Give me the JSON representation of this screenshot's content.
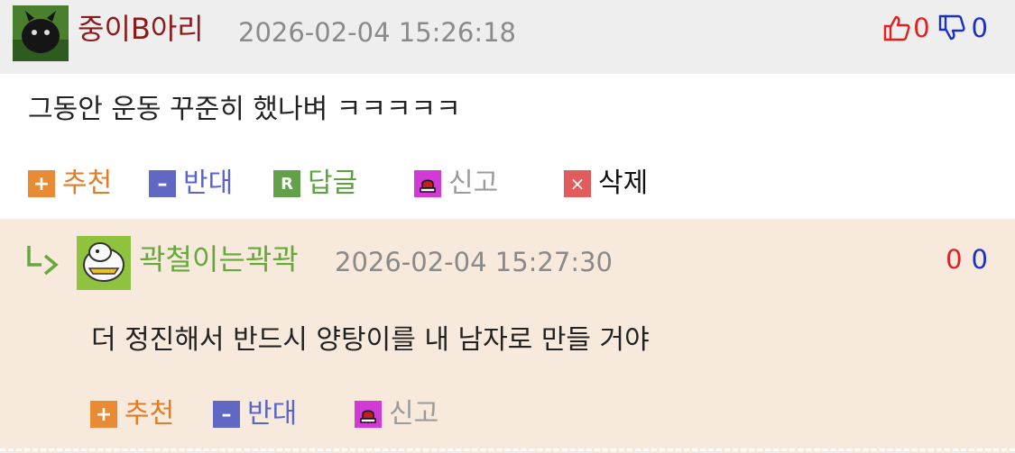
{
  "comment": {
    "author": "중이B아리",
    "timestamp": "2026-02-04 15:26:18",
    "upvotes": "0",
    "downvotes": "0",
    "text": "그동안 운동 꾸준히 했나벼 ㅋㅋㅋㅋㅋ",
    "actions": {
      "recommend": "추천",
      "oppose": "반대",
      "reply": "답글",
      "report": "신고",
      "delete": "삭제"
    }
  },
  "reply": {
    "author": "곽철이는곽곽",
    "timestamp": "2026-02-04 15:27:30",
    "upvotes": "0",
    "downvotes": "0",
    "text": "더 정진해서 반드시 양탕이를 내 남자로 만들 거야",
    "actions": {
      "recommend": "추천",
      "oppose": "반대",
      "report": "신고"
    }
  },
  "icons": {
    "plus": "+",
    "minus": "–",
    "reply": "R",
    "delete": "×"
  },
  "colors": {
    "header_bg": "#eeeeee",
    "reply_bg": "#f7e9dc",
    "author1": "#8b1a1a",
    "author2": "#66a83a",
    "up": "#e0201f",
    "down": "#1a2fc7"
  }
}
